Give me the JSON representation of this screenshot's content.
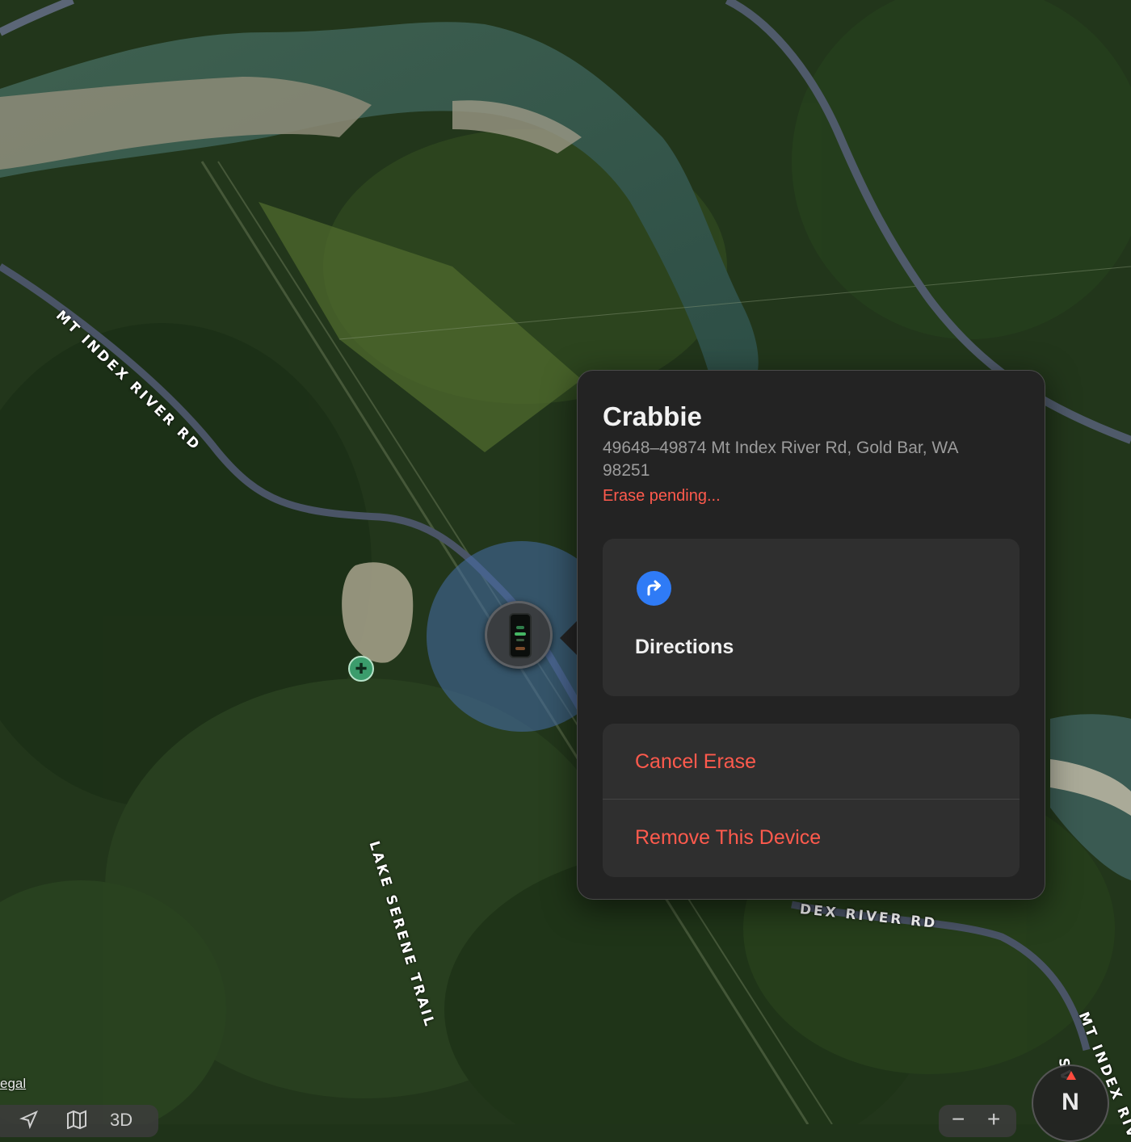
{
  "map": {
    "road_labels": [
      "MT INDEX RIVER RD",
      "LAKE SERENE TRAIL",
      "DEX RIVER RD",
      "MT INDEX RIV",
      "SV"
    ],
    "legal_label": "egal",
    "controls": {
      "location_icon": "location-arrow-icon",
      "map_icon": "map-icon",
      "label_3d": "3D",
      "zoom_out": "−",
      "zoom_in": "+"
    },
    "compass_label": "N",
    "trail_icon": "trailhead-icon"
  },
  "device": {
    "name": "Crabbie",
    "address": "49648–49874 Mt Index River Rd, Gold Bar, WA  98251",
    "status": "Erase pending..."
  },
  "popover": {
    "directions_label": "Directions",
    "directions_icon": "directions-arrow-icon",
    "cancel_erase_label": "Cancel Erase",
    "remove_device_label": "Remove This Device"
  },
  "colors": {
    "accent_blue": "#2f7bf6",
    "destructive_red": "#ff5a4d",
    "popover_bg": "#232323",
    "card_bg": "#2f2f2f"
  }
}
